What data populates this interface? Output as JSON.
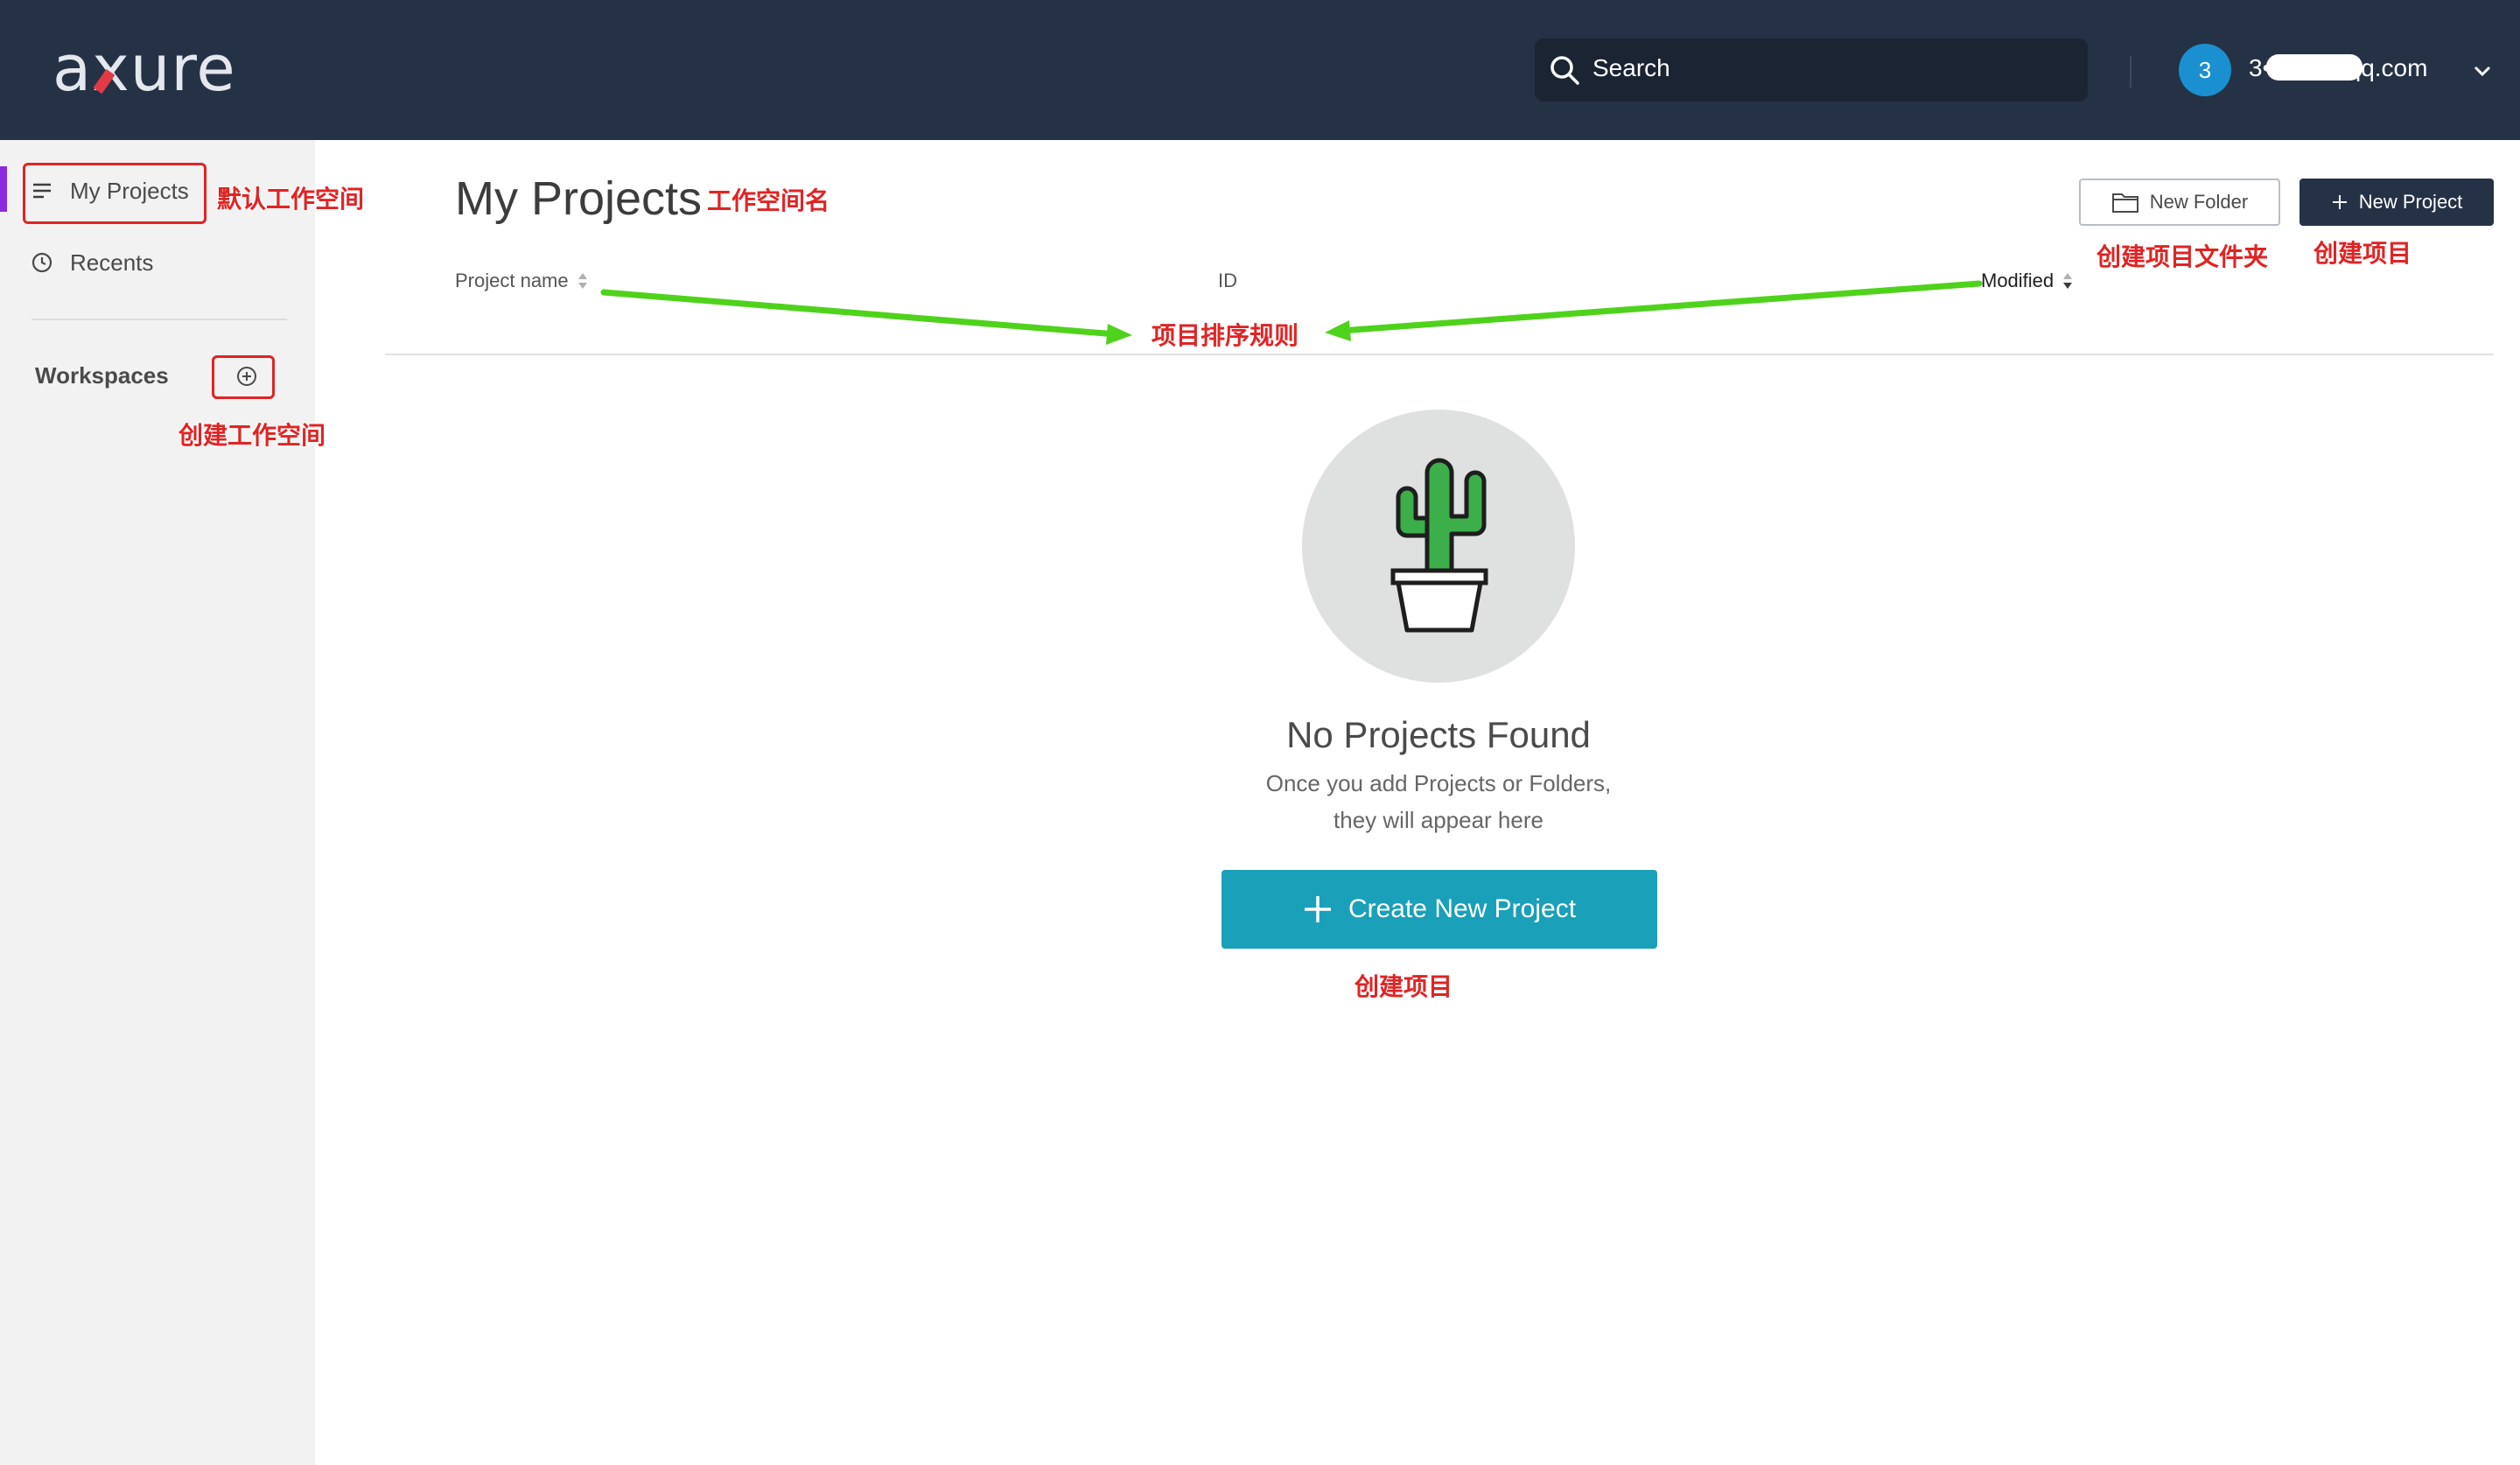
{
  "header": {
    "logo": "axure",
    "search_label": "Search",
    "avatar_initial": "3",
    "user_email": "3•••••••@qq.com"
  },
  "sidebar": {
    "items": [
      {
        "label": "My Projects",
        "icon": "list-icon",
        "active": true
      },
      {
        "label": "Recents",
        "icon": "clock-icon",
        "active": false
      }
    ],
    "workspaces_label": "Workspaces"
  },
  "main": {
    "title": "My Projects",
    "new_folder_label": "New Folder",
    "new_project_label": "New Project",
    "columns": [
      "Project name",
      "ID",
      "Modified"
    ],
    "empty_state": {
      "title": "No Projects Found",
      "subtitle_line1": "Once you add Projects or Folders,",
      "subtitle_line2": "they will appear here",
      "button_label": "Create New Project",
      "illustration": "cactus-icon"
    }
  },
  "annotations": {
    "default_workspace": "默认工作空间",
    "workspace_name": "工作空间名",
    "create_workspace": "创建工作空间",
    "create_folder": "创建项目文件夹",
    "create_project_top": "创建项目",
    "sort_rules": "项目排序规则",
    "create_project_bottom": "创建项目"
  },
  "colors": {
    "header_bg": "#253246",
    "sidebar_bg": "#f2f2f2",
    "accent_teal": "#1aa0b8",
    "annotation_red": "#e02424",
    "annotation_arrow_green": "#4fd21b",
    "active_marker": "#8a2be2"
  }
}
